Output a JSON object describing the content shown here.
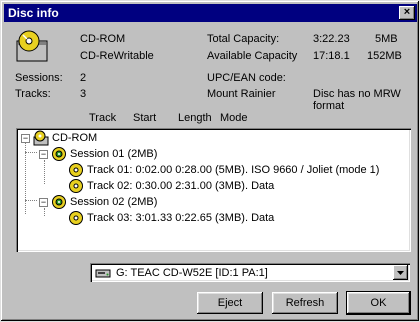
{
  "window": {
    "title": "Disc info",
    "close_label": "×"
  },
  "disc": {
    "type": "CD-ROM",
    "subtype": "CD-ReWritable",
    "sessions_label": "Sessions:",
    "sessions_value": "2",
    "tracks_label": "Tracks:",
    "tracks_value": "3"
  },
  "capacity": {
    "total_label": "Total Capacity:",
    "total_time": "3:22.23",
    "total_size": "5MB",
    "available_label": "Available Capacity",
    "available_time": "17:18.1",
    "available_size": "152MB",
    "upc_label": "UPC/EAN code:",
    "mount_label": "Mount Rainier",
    "mount_value_line1": "Disc has no MRW",
    "mount_value_line2": "format"
  },
  "columns": {
    "track": "Track",
    "start": "Start",
    "length": "Length",
    "mode": "Mode"
  },
  "tree": {
    "root": "CD-ROM",
    "session1": "Session 01   (2MB)",
    "track1": "Track 01: 0:02.00   0:28.00   (5MB).   ISO 9660 / Joliet (mode 1)",
    "track2": "Track 02: 0:30.00   2:31.00   (3MB).   Data",
    "session2": "Session 02   (2MB)",
    "track3": "Track 03: 3:01.33   0:22.65   (3MB).   Data"
  },
  "drive": {
    "selected": "G: TEAC   CD-W52E [ID:1 PA:1]"
  },
  "buttons": {
    "eject": "Eject",
    "refresh": "Refresh",
    "ok": "OK"
  },
  "colors": {
    "titlebar": "#000080",
    "face": "#c0c0c0",
    "accent_yellow": "#e8d020",
    "accent_green": "#2a9a2a"
  }
}
